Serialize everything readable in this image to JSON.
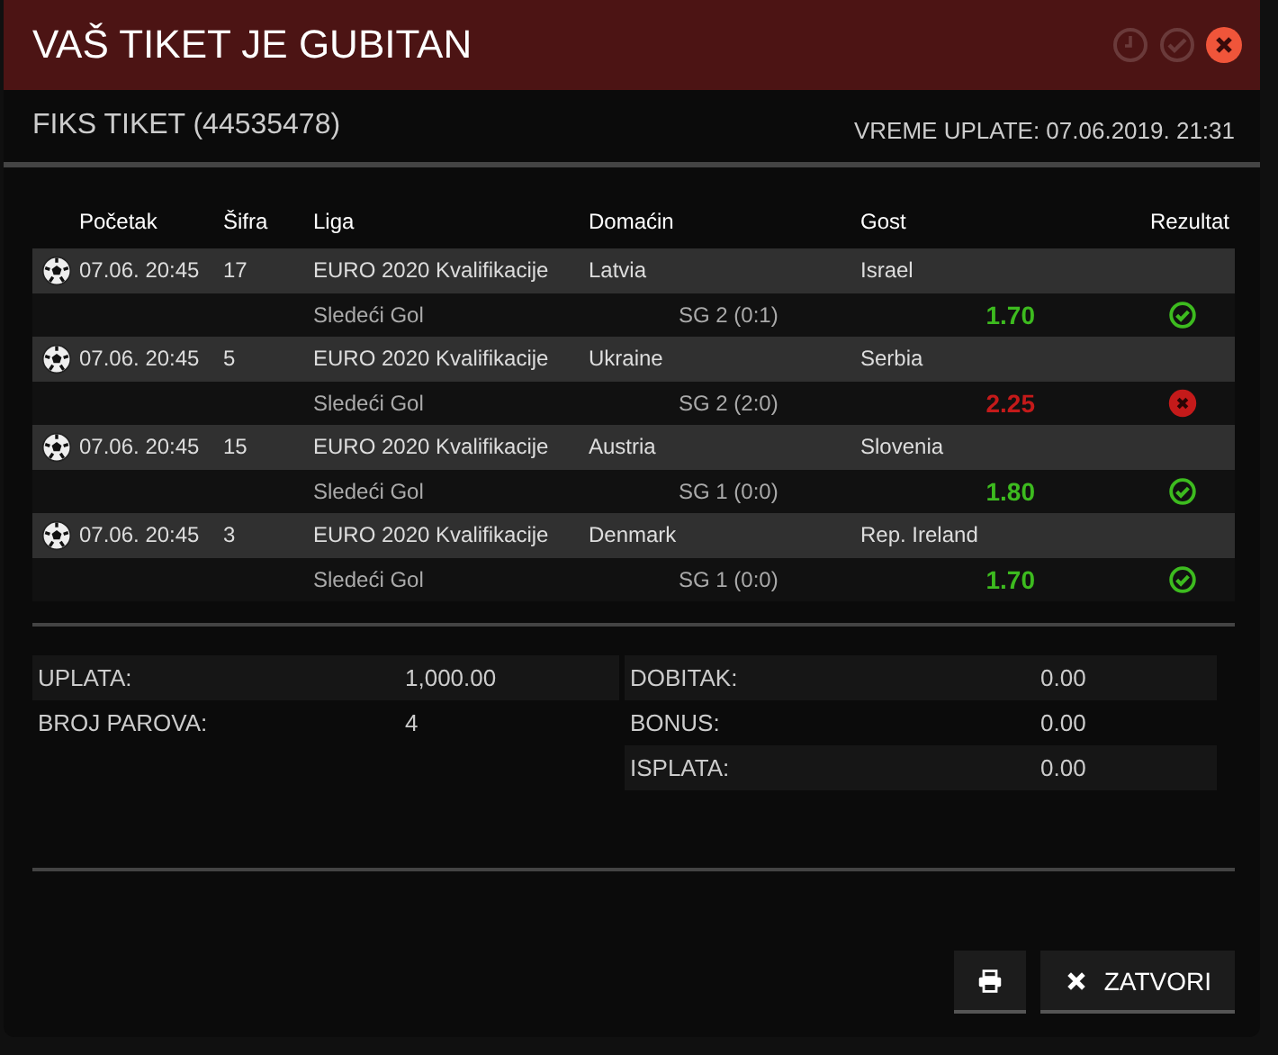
{
  "window": {
    "title": "VAŠ TIKET JE GUBITAN"
  },
  "ticket": {
    "name": "FIKS TIKET (44535478)",
    "payment_time": "VREME UPLATE: 07.06.2019. 21:31"
  },
  "table": {
    "columns": [
      "Početak",
      "Šifra",
      "Liga",
      "Domaćin",
      "Gost",
      "Rezultat"
    ],
    "rows": [
      {
        "start": "07.06. 20:45",
        "code": "17",
        "league": "EURO 2020 Kvalifikacije",
        "home": "Latvia",
        "away": "Israel",
        "market": "Sledeći Gol",
        "pick": "SG 2 (0:1)",
        "odds": "1.70",
        "kind": "won"
      },
      {
        "start": "07.06. 20:45",
        "code": "5",
        "league": "EURO 2020 Kvalifikacije",
        "home": "Ukraine",
        "away": "Serbia",
        "market": "Sledeći Gol",
        "pick": "SG 2 (2:0)",
        "odds": "2.25",
        "kind": "lost"
      },
      {
        "start": "07.06. 20:45",
        "code": "15",
        "league": "EURO 2020 Kvalifikacije",
        "home": "Austria",
        "away": "Slovenia",
        "market": "Sledeći Gol",
        "pick": "SG 1 (0:0)",
        "odds": "1.80",
        "kind": "won"
      },
      {
        "start": "07.06. 20:45",
        "code": "3",
        "league": "EURO 2020 Kvalifikacije",
        "home": "Denmark",
        "away": "Rep. Ireland",
        "market": "Sledeći Gol",
        "pick": "SG 1 (0:0)",
        "odds": "1.70",
        "kind": "won"
      }
    ]
  },
  "summary_left": [
    {
      "label": "UPLATA:",
      "value": "1,000.00"
    },
    {
      "label": "BROJ PAROVA:",
      "value": "4"
    }
  ],
  "summary_right": [
    {
      "label": "DOBITAK:",
      "value": "0.00"
    },
    {
      "label": "BONUS:",
      "value": "0.00"
    },
    {
      "label": "ISPLATA:",
      "value": "0.00"
    }
  ],
  "buttons": [
    {
      "kind": "print"
    },
    {
      "kind": "close",
      "label": "ZATVORI"
    }
  ]
}
